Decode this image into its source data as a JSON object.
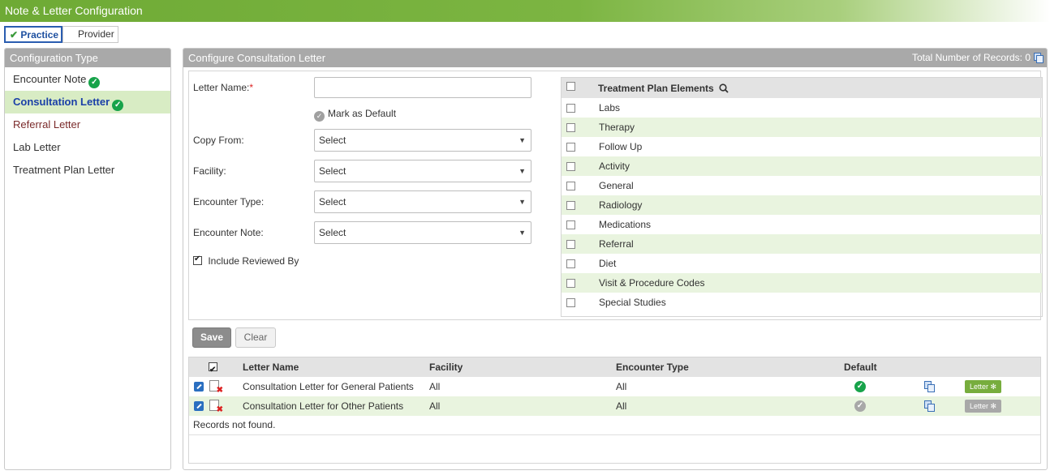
{
  "window": {
    "title": "Note & Letter Configuration"
  },
  "scope": {
    "practice": "Practice",
    "provider": "Provider"
  },
  "config_type": {
    "header": "Configuration Type",
    "items": [
      {
        "label": "Encounter Note",
        "configured": true
      },
      {
        "label": "Consultation Letter",
        "configured": true,
        "active": true
      },
      {
        "label": "Referral Letter"
      },
      {
        "label": "Lab Letter"
      },
      {
        "label": "Treatment Plan Letter"
      }
    ]
  },
  "main": {
    "header": "Configure Consultation Letter",
    "records_label": "Total Number of Records: 0"
  },
  "form": {
    "letter_name_label": "Letter Name:",
    "required_mark": "*",
    "letter_name_value": "",
    "mark_default_label": "Mark as Default",
    "copy_from_label": "Copy From:",
    "copy_from_value": "Select",
    "facility_label": "Facility:",
    "facility_value": "Select",
    "encounter_type_label": "Encounter Type:",
    "encounter_type_value": "Select",
    "encounter_note_label": "Encounter Note:",
    "encounter_note_value": "Select",
    "include_reviewed_label": "Include Reviewed By",
    "include_reviewed_checked": true
  },
  "treatment_plan": {
    "title": "Treatment Plan Elements",
    "items": [
      "Labs",
      "Therapy",
      "Follow Up",
      "Activity",
      "General",
      "Radiology",
      "Medications",
      "Referral",
      "Diet",
      "Visit & Procedure Codes",
      "Special Studies"
    ]
  },
  "buttons": {
    "save": "Save",
    "clear": "Clear"
  },
  "grid": {
    "columns": {
      "letter_name": "Letter Name",
      "facility": "Facility",
      "encounter_type": "Encounter Type",
      "default": "Default"
    },
    "rows": [
      {
        "letter_name": "Consultation Letter for General Patients",
        "facility": "All",
        "encounter_type": "All",
        "is_default": true,
        "letter_btn": "Letter"
      },
      {
        "letter_name": "Consultation Letter for Other Patients",
        "facility": "All",
        "encounter_type": "All",
        "is_default": false,
        "letter_btn": "Letter"
      }
    ],
    "empty_text": "Records not found."
  },
  "colors": {
    "accent_green": "#7cb542",
    "active_row": "#d8ecc4",
    "link_blue": "#1a3fa8",
    "header_grey": "#a9a9a9"
  }
}
